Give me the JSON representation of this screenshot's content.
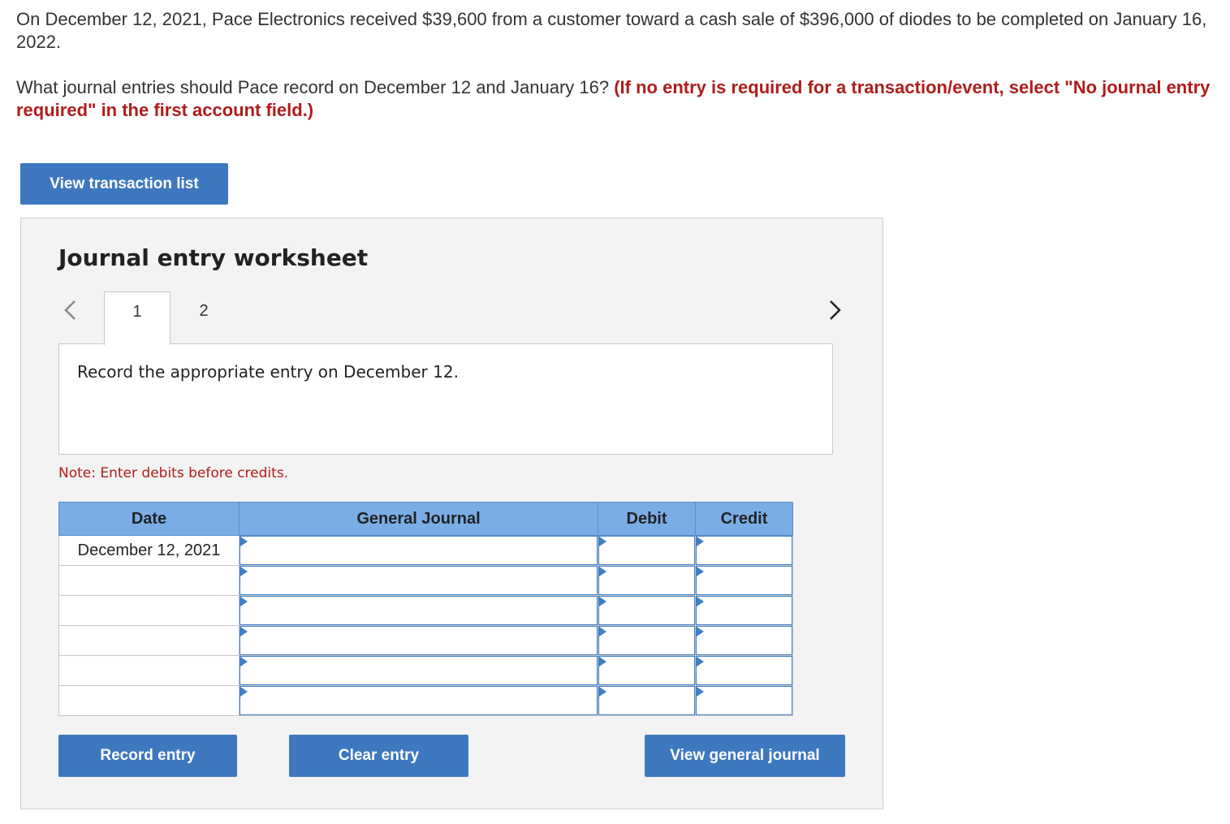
{
  "question": {
    "text": "On December 12, 2021, Pace Electronics received $39,600 from a customer toward a cash sale of $396,000 of diodes to be completed on January 16, 2022.",
    "prompt": "What journal entries should Pace record on December 12 and January 16? ",
    "instruction": "(If no entry is required for a transaction/event, select \"No journal entry required\" in the first account field.)"
  },
  "buttons": {
    "view_transaction_list": "View transaction list",
    "record_entry": "Record entry",
    "clear_entry": "Clear entry",
    "view_general_journal": "View general journal"
  },
  "worksheet": {
    "title": "Journal entry worksheet",
    "tabs": [
      "1",
      "2"
    ],
    "active_tab": "1",
    "instruction": "Record the appropriate entry on December 12.",
    "note": "Note: Enter debits before credits."
  },
  "journal": {
    "headers": {
      "date": "Date",
      "account": "General Journal",
      "debit": "Debit",
      "credit": "Credit"
    },
    "rows": [
      {
        "date": "December 12, 2021"
      },
      {
        "date": ""
      },
      {
        "date": ""
      },
      {
        "date": ""
      },
      {
        "date": ""
      },
      {
        "date": ""
      }
    ]
  },
  "colors": {
    "accent": "#3d78bf",
    "header": "#7aade6",
    "emphasis": "#b01c1c"
  },
  "icons": {
    "prev": "chevron-left-icon",
    "next": "chevron-right-icon"
  }
}
